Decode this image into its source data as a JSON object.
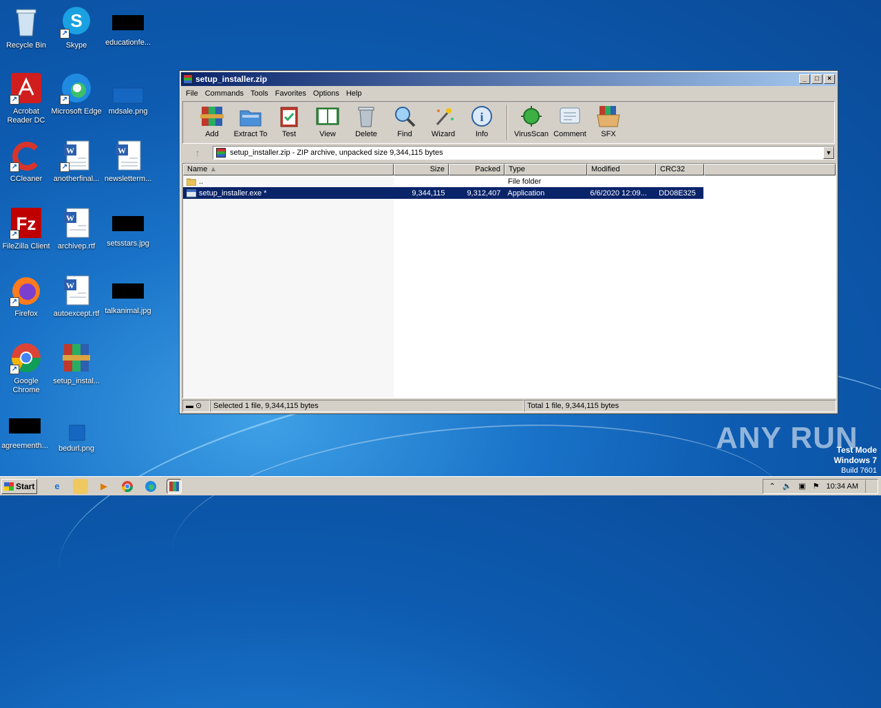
{
  "desktop": {
    "icons": [
      {
        "label": "Recycle Bin"
      },
      {
        "label": "Skype"
      },
      {
        "label": "educationfe..."
      },
      {
        "label": "Acrobat Reader DC"
      },
      {
        "label": "Microsoft Edge"
      },
      {
        "label": "mdsale.png"
      },
      {
        "label": "CCleaner"
      },
      {
        "label": "anotherfinal..."
      },
      {
        "label": "newsletterm..."
      },
      {
        "label": "FileZilla Client"
      },
      {
        "label": "archivep.rtf"
      },
      {
        "label": "setsstars.jpg"
      },
      {
        "label": "Firefox"
      },
      {
        "label": "autoexcept.rtf"
      },
      {
        "label": "talkanimal.jpg"
      },
      {
        "label": "Google Chrome"
      },
      {
        "label": "setup_instal..."
      },
      {
        "label": "agreementh..."
      },
      {
        "label": "bedurl.png"
      }
    ]
  },
  "window": {
    "title": "setup_installer.zip",
    "menu": [
      "File",
      "Commands",
      "Tools",
      "Favorites",
      "Options",
      "Help"
    ],
    "toolbar": [
      "Add",
      "Extract To",
      "Test",
      "View",
      "Delete",
      "Find",
      "Wizard",
      "Info",
      "VirusScan",
      "Comment",
      "SFX"
    ],
    "path": "setup_installer.zip - ZIP archive, unpacked size 9,344,115 bytes",
    "columns": [
      "Name",
      "Size",
      "Packed",
      "Type",
      "Modified",
      "CRC32"
    ],
    "rows": [
      {
        "name": "..",
        "size": "",
        "packed": "",
        "type": "File folder",
        "modified": "",
        "crc": ""
      },
      {
        "name": "setup_installer.exe *",
        "size": "9,344,115",
        "packed": "9,312,407",
        "type": "Application",
        "modified": "6/6/2020 12:09...",
        "crc": "DD08E325"
      }
    ],
    "status_left": "Selected 1 file, 9,344,115 bytes",
    "status_right": "Total 1 file, 9,344,115 bytes"
  },
  "watermark": {
    "brand": "ANY RUN",
    "test_mode": "Test Mode",
    "os": "Windows 7",
    "build": "Build 7601"
  },
  "taskbar": {
    "start": "Start",
    "clock": "10:34 AM"
  }
}
